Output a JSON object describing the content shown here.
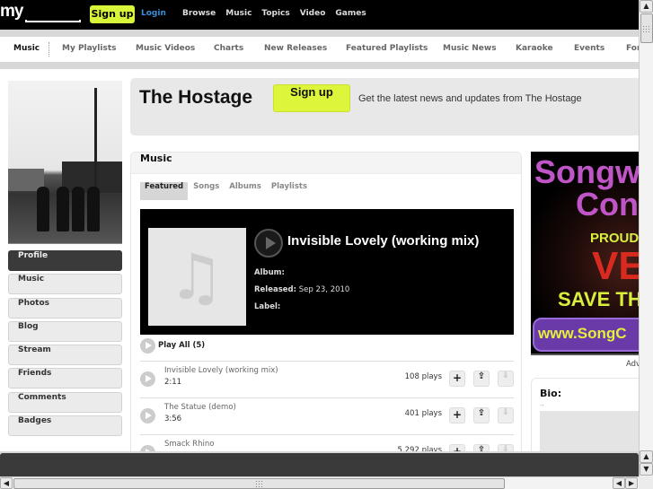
{
  "topbar": {
    "logo": "my",
    "signup": "Sign up",
    "login": "Login",
    "nav": [
      "Browse",
      "Music",
      "Topics",
      "Video",
      "Games"
    ]
  },
  "subnav": {
    "items": [
      {
        "label": "Music",
        "active": true
      },
      {
        "label": "My Playlists"
      },
      {
        "label": "Music Videos"
      },
      {
        "label": "Charts"
      },
      {
        "label": "New Releases"
      },
      {
        "label": "Featured Playlists"
      },
      {
        "label": "Music News"
      },
      {
        "label": "Karaoke"
      },
      {
        "label": "Events"
      },
      {
        "label": "For"
      }
    ]
  },
  "header": {
    "artist": "The Hostage",
    "signup": "Sign up",
    "message": "Get the latest news and updates from The Hostage"
  },
  "sidebar": {
    "items": [
      "Profile",
      "Music",
      "Photos",
      "Blog",
      "Stream",
      "Friends",
      "Comments",
      "Badges"
    ],
    "active": "Profile"
  },
  "music": {
    "title": "Music",
    "tabs": [
      "Featured",
      "Songs",
      "Albums",
      "Playlists"
    ],
    "active_tab": "Featured",
    "featured": {
      "label": "",
      "title": "Invisible Lovely (working mix)",
      "album_label": "Album:",
      "album": "",
      "released_label": "Released:",
      "released": "Sep 23, 2010",
      "label_label": "Label:"
    },
    "play_all": "Play All (5)",
    "songs": [
      {
        "title": "Invisible Lovely (working mix)",
        "duration": "2:11",
        "plays": "108 plays"
      },
      {
        "title": "The Statue (demo)",
        "duration": "3:56",
        "plays": "401 plays"
      },
      {
        "title": "Smack Rhino",
        "duration": "",
        "plays": "5,292 plays"
      }
    ]
  },
  "ad": {
    "line1": "Songw",
    "line2": "Con",
    "line3": "PROUD S",
    "line4": "VE",
    "line5": "SAVE TH",
    "line6": "www.SongC",
    "label": "Adv"
  },
  "bio": {
    "title": "Bio:",
    "text": ".."
  },
  "icons": {
    "add": "+",
    "share": "⇪",
    "download": "⇩",
    "up": "▲",
    "down": "▼",
    "left": "◀",
    "right": "▶"
  }
}
